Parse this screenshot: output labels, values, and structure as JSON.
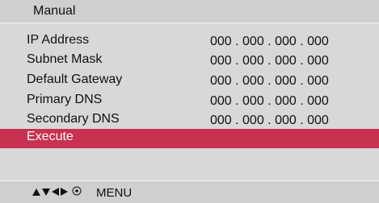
{
  "header": {
    "title": "Manual"
  },
  "settings": [
    {
      "label": "IP Address",
      "value": "000 . 000 . 000 . 000"
    },
    {
      "label": "Subnet Mask",
      "value": "000 . 000 . 000 . 000"
    },
    {
      "label": "Default Gateway",
      "value": "000 . 000 . 000 . 000"
    },
    {
      "label": "Primary DNS",
      "value": "000 . 000 . 000 . 000"
    },
    {
      "label": "Secondary DNS",
      "value": "000 . 000 . 000 . 000"
    }
  ],
  "execute": {
    "label": "Execute"
  },
  "footer": {
    "icons": [
      "up-arrow-icon",
      "down-arrow-icon",
      "left-arrow-icon",
      "right-arrow-icon",
      "enter-button-icon"
    ],
    "menu_label": "MENU"
  },
  "colors": {
    "highlight": "#c8314f",
    "panel": "#d8d8d8",
    "bar": "#cfcfcf"
  }
}
